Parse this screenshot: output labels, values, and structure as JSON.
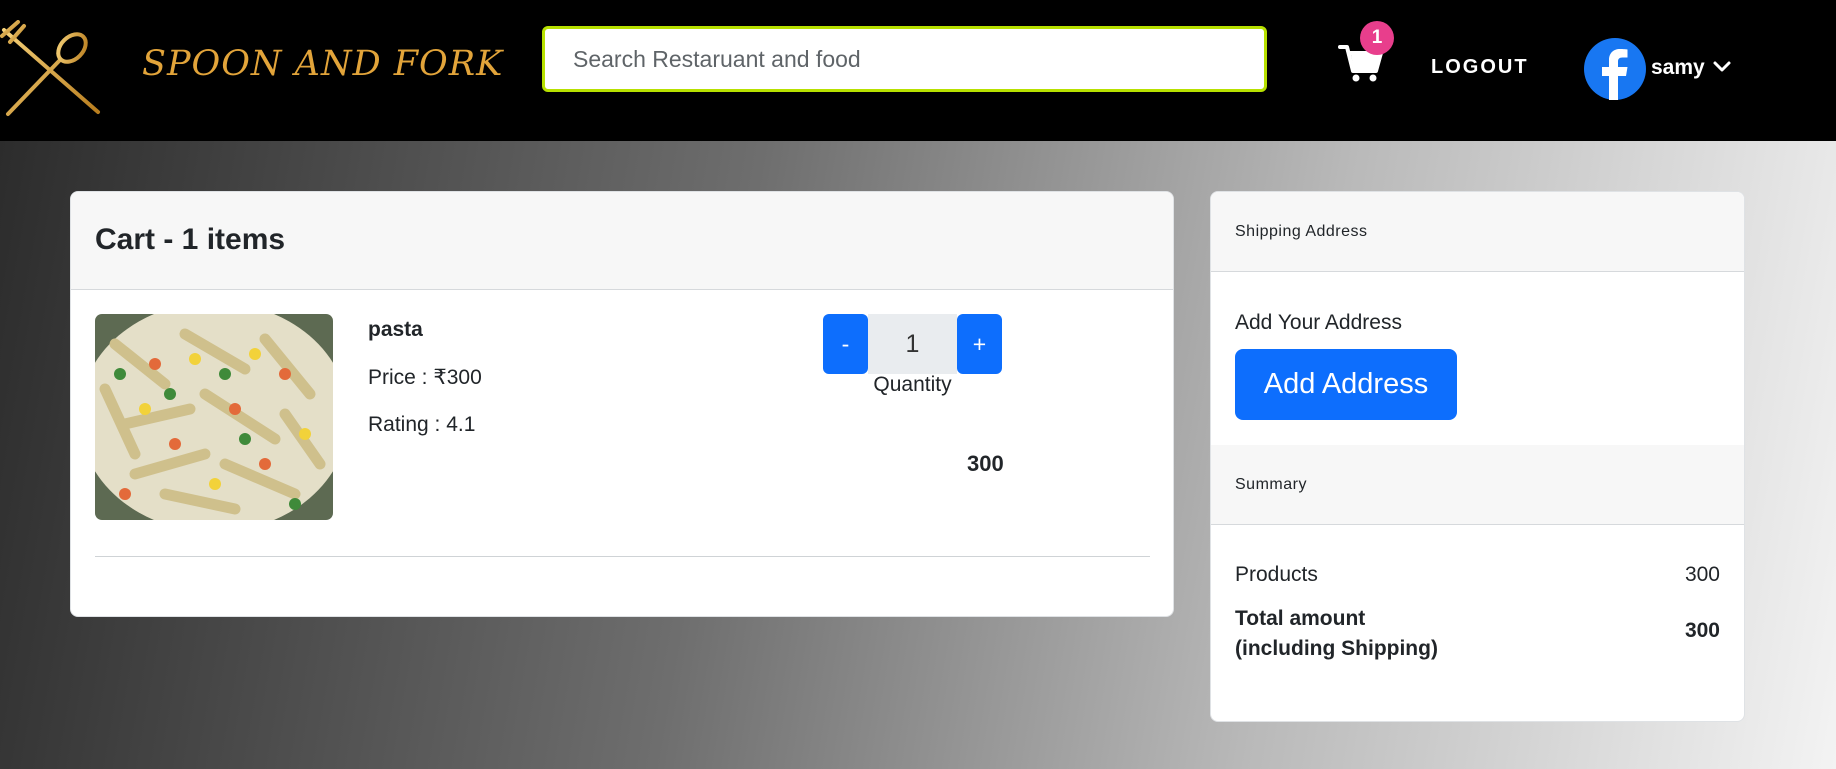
{
  "header": {
    "brand": "SPOON AND FORK",
    "search_placeholder": "Search Restaruant and food",
    "cart_count": "1",
    "logout_label": "LOGOUT",
    "user_name": "samy"
  },
  "cart": {
    "title": "Cart - 1 items",
    "items": [
      {
        "name": "pasta",
        "price_text": "Price : ₹300",
        "rating_text": "Rating : 4.1",
        "quantity": "1",
        "minus_label": "-",
        "plus_label": "+",
        "quantity_label": "Quantity",
        "line_total": "300"
      }
    ]
  },
  "shipping": {
    "header": "Shipping Address",
    "add_label": "Add Your Address",
    "add_button": "Add Address"
  },
  "summary": {
    "header": "Summary",
    "products_label": "Products",
    "products_value": "300",
    "total_label": "Total amount\n(including Shipping)",
    "total_value": "300"
  },
  "colors": {
    "brand_gold": "#e2a43a",
    "primary_blue": "#0d6efd",
    "badge_pink": "#e83e8c",
    "search_border": "#b7e000",
    "facebook_blue": "#1877f2"
  },
  "icons": {
    "logo": "spoon-and-fork-icon",
    "cart": "shopping-cart-icon",
    "avatar": "facebook-icon",
    "dropdown": "chevron-down-icon"
  }
}
